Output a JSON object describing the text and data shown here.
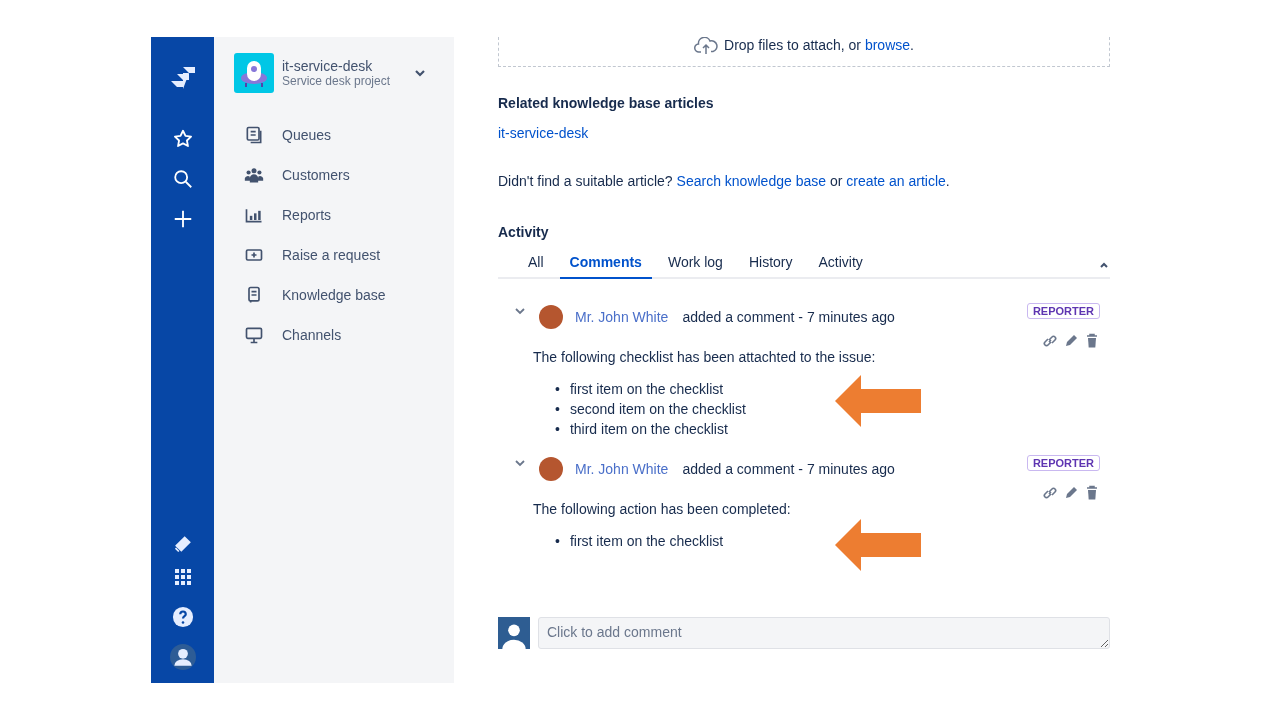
{
  "project": {
    "name": "it-service-desk",
    "subtitle": "Service desk project"
  },
  "sidebar": {
    "items": [
      {
        "label": "Queues"
      },
      {
        "label": "Customers"
      },
      {
        "label": "Reports"
      },
      {
        "label": "Raise a request"
      },
      {
        "label": "Knowledge base"
      },
      {
        "label": "Channels"
      }
    ]
  },
  "dropzone": [
    {
      "kind": "text",
      "text": "Drop files to attach, or "
    },
    {
      "kind": "link",
      "text": "browse"
    },
    {
      "kind": "text",
      "text": "."
    }
  ],
  "related": {
    "heading": "Related knowledge base articles",
    "articles": [
      "it-service-desk"
    ],
    "suggestion": [
      {
        "kind": "text",
        "text": "Didn't find a suitable article? "
      },
      {
        "kind": "link",
        "text": "Search knowledge base"
      },
      {
        "kind": "text",
        "text": " or "
      },
      {
        "kind": "link",
        "text": "create an article"
      },
      {
        "kind": "text",
        "text": "."
      }
    ]
  },
  "activity": {
    "heading": "Activity",
    "tabs": [
      {
        "label": "All",
        "selected": false
      },
      {
        "label": "Comments",
        "selected": true
      },
      {
        "label": "Work log",
        "selected": false
      },
      {
        "label": "History",
        "selected": false
      },
      {
        "label": "Activity",
        "selected": false
      }
    ],
    "comments": [
      {
        "author": "Mr. John White",
        "meta": "added a comment - 7 minutes ago",
        "badge": "REPORTER",
        "bullet": "•",
        "body": "The following checklist has been attachted to the issue:",
        "items": [
          "first item on the checklist",
          "second item on the checklist",
          "third item on the checklist"
        ]
      },
      {
        "author": "Mr. John White",
        "meta": "added a comment - 7 minutes ago",
        "badge": "REPORTER",
        "bullet": "•",
        "body": "The following action has been completed:",
        "items": [
          "first item on the checklist"
        ]
      }
    ],
    "comment_field": {
      "placeholder": "Click to add comment"
    }
  }
}
